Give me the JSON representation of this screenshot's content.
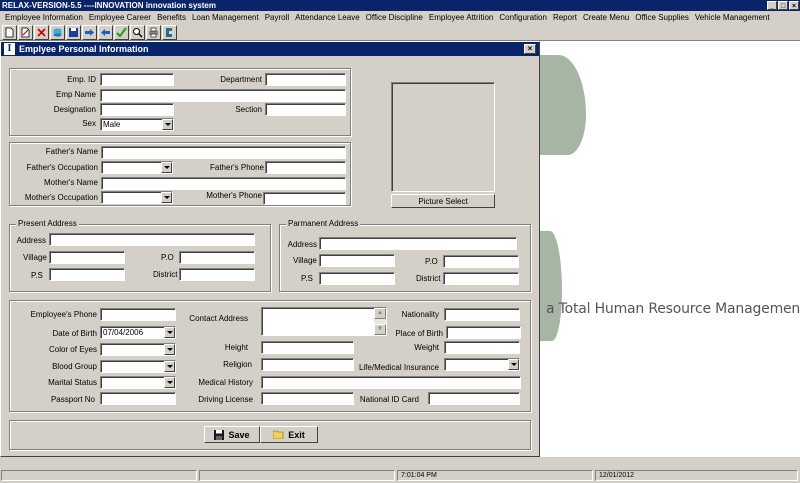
{
  "app": {
    "title": "RELAX-VERSION-5.5 ----INNOVATION innovation system"
  },
  "menu": [
    "Employee Information",
    "Employee Career",
    "Benefits",
    "Loan Management",
    "Payroll",
    "Attendance Leave",
    "Office Discipline",
    "Employee Attrition",
    "Configuration",
    "Report",
    "Create Menu",
    "Office Supplies",
    "Vehicle Management"
  ],
  "toolbar_icons": [
    "new-icon",
    "edit-icon",
    "delete-icon",
    "database-icon",
    "save-icon",
    "forward-icon",
    "back-icon",
    "check-icon",
    "search-icon",
    "print-icon",
    "exit-icon"
  ],
  "background": {
    "tagline": "a Total Human Resource Management"
  },
  "window": {
    "title": "Emplyee Personal Information",
    "title_icon": "I",
    "close": "×"
  },
  "basic": {
    "emp_id_label": "Emp. ID",
    "emp_id": "",
    "department_label": "Department",
    "department": "",
    "emp_name_label": "Emp Name",
    "emp_name": "",
    "designation_label": "Designation",
    "designation": "",
    "section_label": "Section",
    "section": "",
    "sex_label": "Sex",
    "sex": "Male"
  },
  "family": {
    "fathers_name_label": "Father's Name",
    "fathers_occupation_label": "Father's Occupation",
    "fathers_phone_label": "Father's Phone",
    "mothers_name_label": "Mother's Name",
    "mothers_occupation_label": "Mother's Occupation",
    "mothers_phone_label": "Mother's Phone"
  },
  "picture": {
    "button_label": "Picture Select"
  },
  "present_address": {
    "title": "Present Address",
    "address_label": "Address",
    "village_label": "Village",
    "po_label": "P.O",
    "ps_label": "P.S",
    "district_label": "District"
  },
  "permanent_address": {
    "title": "Parmanent Address",
    "address_label": "Address",
    "village_label": "Village",
    "po_label": "P.O",
    "ps_label": "P.S",
    "district_label": "District"
  },
  "details": {
    "employee_phone_label": "Employee's Phone",
    "contact_address_label": "Contact Address",
    "nationality_label": "Nationality",
    "dob_label": "Date of Birth",
    "dob": "07/04/2006",
    "place_of_birth_label": "Place of Birth",
    "color_of_eyes_label": "Color of Eyes",
    "height_label": "Height",
    "weight_label": "Weight",
    "blood_group_label": "Blood Group",
    "religion_label": "Religion",
    "insurance_label": "Life/Medical Insurance",
    "marital_status_label": "Marital Status",
    "medical_history_label": "Medical History",
    "passport_label": "Passport No",
    "driving_license_label": "Driving License",
    "national_id_label": "National ID Card"
  },
  "actions": {
    "save_label": "Save",
    "exit_label": "Exit"
  },
  "status": {
    "time": "7:01:04 PM",
    "date": "12/01/2012"
  },
  "colors": {
    "titlebar": "#0a246a",
    "face": "#d4d0c8"
  }
}
